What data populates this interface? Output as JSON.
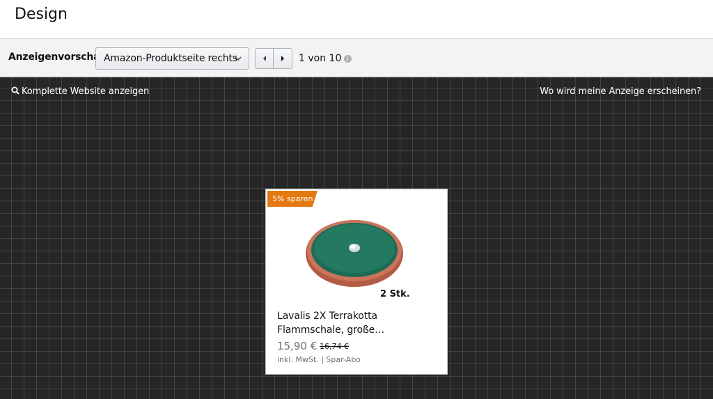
{
  "page": {
    "title": "Design"
  },
  "toolbar": {
    "preview_label": "Anzeigenvorschau",
    "placement_select": {
      "value": "Amazon-Produktseite rechts"
    },
    "pager": {
      "prev_icon": "chevron-left-icon",
      "next_icon": "chevron-right-icon",
      "count_text": "1 von 10"
    },
    "info_icon": "info-icon"
  },
  "canvas": {
    "show_full_site_link": "Komplette Website anzeigen",
    "where_link": "Wo wird meine Anzeige erscheinen?",
    "background_color": "#262626"
  },
  "ad": {
    "badge": "5% sparen",
    "badge_color": "#e47911",
    "image_caption": "2 Stk.",
    "title": "Lavalis 2X Terrakotta Flammschale, große…",
    "price": "15,90 €",
    "old_price": "16,74 €",
    "tax_note": "inkl. MwSt. | Spar-Abo"
  }
}
